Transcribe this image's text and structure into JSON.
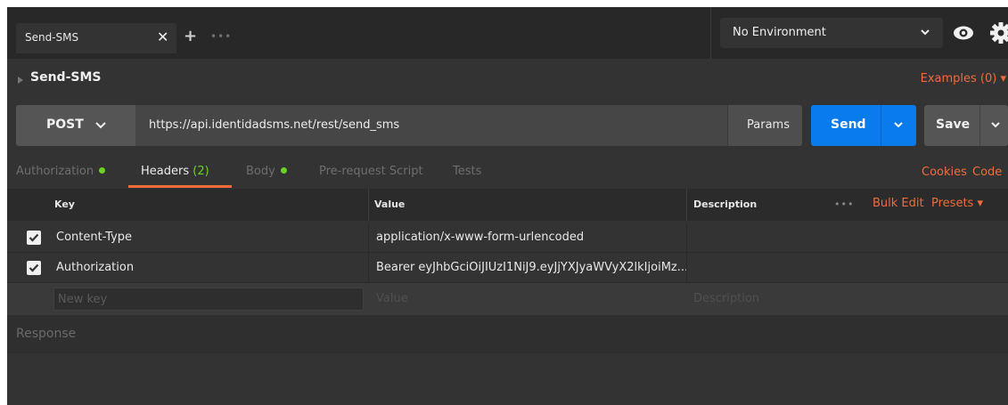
{
  "tabbar": {
    "tab_title": "Send-SMS",
    "close_glyph": "✕",
    "add_glyph": "+",
    "more_glyph": "•••",
    "environment": "No Environment"
  },
  "request": {
    "name": "Send-SMS",
    "examples_label": "Examples (0) ▾",
    "method": "POST",
    "url": "https://api.identidadsms.net/rest/send_sms",
    "params_label": "Params",
    "send_label": "Send",
    "save_label": "Save"
  },
  "subtabs": {
    "authorization": "Authorization",
    "headers": "Headers",
    "headers_count": "(2)",
    "body": "Body",
    "prerequest": "Pre-request Script",
    "tests": "Tests",
    "cookies": "Cookies",
    "code": "Code"
  },
  "headers_table": {
    "col_key": "Key",
    "col_value": "Value",
    "col_description": "Description",
    "more_glyph": "•••",
    "bulk_edit": "Bulk Edit",
    "presets": "Presets ▾",
    "rows": [
      {
        "checked": true,
        "key": "Content-Type",
        "value": "application/x-www-form-urlencoded",
        "description": ""
      },
      {
        "checked": true,
        "key": "Authorization",
        "value": "Bearer eyJhbGciOiJIUzI1NiJ9.eyJjYXJyaWVyX2lkIjoiMz...",
        "description": ""
      }
    ],
    "new_key_placeholder": "New key",
    "new_value_placeholder": "Value",
    "new_description_placeholder": "Description"
  },
  "response": {
    "label": "Response"
  },
  "colors": {
    "accent": "#f26b3a",
    "send": "#097bed",
    "ok_dot": "#6bd124"
  }
}
